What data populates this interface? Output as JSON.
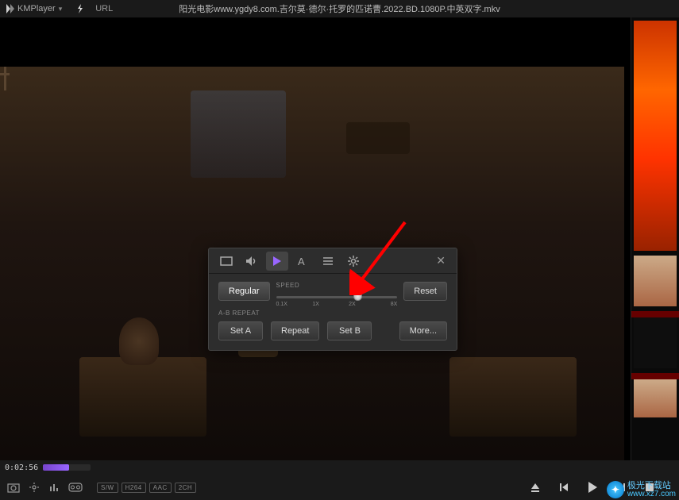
{
  "app": {
    "name": "KMPlayer",
    "url_label": "URL"
  },
  "title": "阳光电影www.ygdy8.com.吉尔莫·德尔·托罗的匹诺曹.2022.BD.1080P.中英双字.mkv",
  "panel": {
    "speed_label": "SPEED",
    "regular": "Regular",
    "reset": "Reset",
    "slider_min": "0.1X",
    "slider_mid": "1X",
    "slider_cur": "2X",
    "slider_max": "8X",
    "slider_pos_pct": 64,
    "abrepeat_label": "A-B REPEAT",
    "set_a": "Set A",
    "repeat": "Repeat",
    "set_b": "Set B",
    "more": "More..."
  },
  "bottom": {
    "time": "0:02:56",
    "badges": {
      "sw": "S/W",
      "h264": "H264",
      "aac": "AAC",
      "ch": "2CH"
    }
  },
  "watermark": {
    "cn": "极光下载站",
    "url": "www.xz7.com"
  }
}
